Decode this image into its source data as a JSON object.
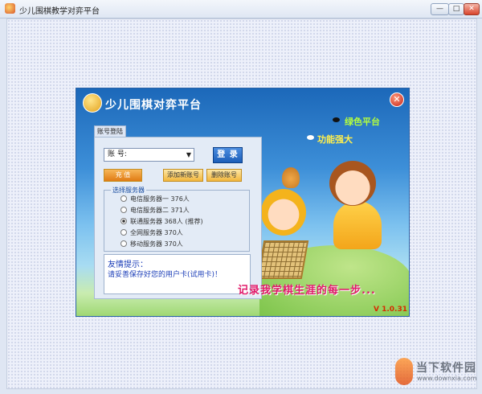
{
  "window": {
    "title": "少儿围棋教学对弈平台",
    "min": "—",
    "max": "□",
    "close": "✕"
  },
  "dialog": {
    "title": "少儿围棋对弈平台",
    "close": "✕",
    "features": [
      "绿色平台",
      "功能强大"
    ],
    "tab_label": "账号登陆",
    "account_label": "账 号:",
    "login_button": "登 录",
    "recharge_button": "充 值",
    "add_account_button": "添加新账号",
    "delete_account_button": "删除账号",
    "server_group_label": "选择服务器",
    "servers": [
      {
        "label": "电信服务器一 376人",
        "selected": false
      },
      {
        "label": "电信服务器二 371人",
        "selected": false
      },
      {
        "label": "联通服务器 368人 (推荐)",
        "selected": true
      },
      {
        "label": "全网服务器 370人",
        "selected": false
      },
      {
        "label": "移动服务器 370人",
        "selected": false
      }
    ],
    "tips_title": "友情提示：",
    "tips_text": "请妥善保存好您的用户卡(试用卡)！",
    "slogan": "记录我学棋生涯的每一步...",
    "version": "V 1.0.31"
  },
  "watermark": {
    "name": "当下软件园",
    "url": "www.downxia.com"
  },
  "colors": {
    "title_blue": "#1c68b9",
    "slogan": "#e01a6a",
    "version": "#d62b00"
  }
}
